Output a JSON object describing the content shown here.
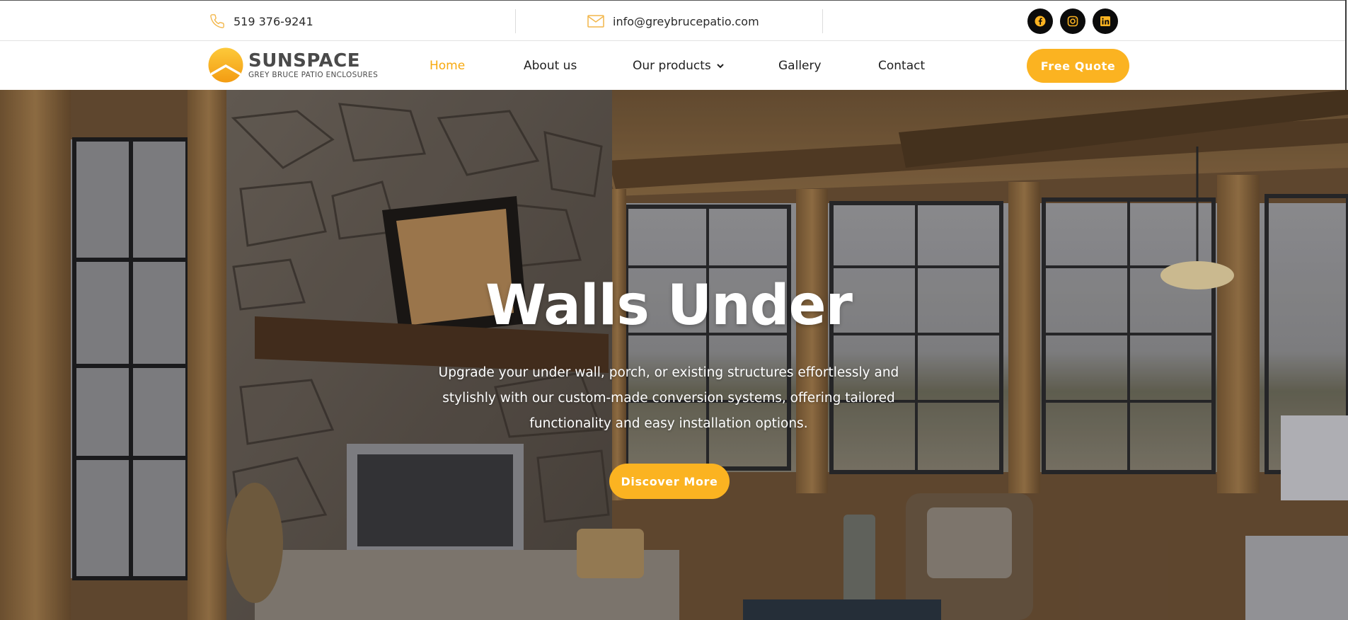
{
  "topbar": {
    "phone": "519 376-9241",
    "email": "info@greybrucepatio.com",
    "phone_icon": "phone-icon",
    "email_icon": "mail-icon",
    "socials": [
      "facebook-icon",
      "instagram-icon",
      "linkedin-icon"
    ]
  },
  "brand": {
    "name": "SUNSPACE",
    "tagline": "GREY BRUCE PATIO ENCLOSURES"
  },
  "nav": {
    "items": [
      {
        "label": "Home",
        "active": true
      },
      {
        "label": "About us",
        "active": false
      },
      {
        "label": "Our products",
        "active": false,
        "has_dropdown": true
      },
      {
        "label": "Gallery",
        "active": false
      },
      {
        "label": "Contact",
        "active": false
      }
    ],
    "cta": "Free Quote"
  },
  "hero": {
    "title": "Walls Under",
    "description": "Upgrade your under wall, porch, or existing structures effortlessly and stylishly with our custom-made conversion systems, offering tailored functionality and easy installation options.",
    "cta": "Discover More"
  },
  "colors": {
    "accent": "#fbb321",
    "active_nav": "#f7a90f",
    "social_bg": "#0b0b0b"
  }
}
